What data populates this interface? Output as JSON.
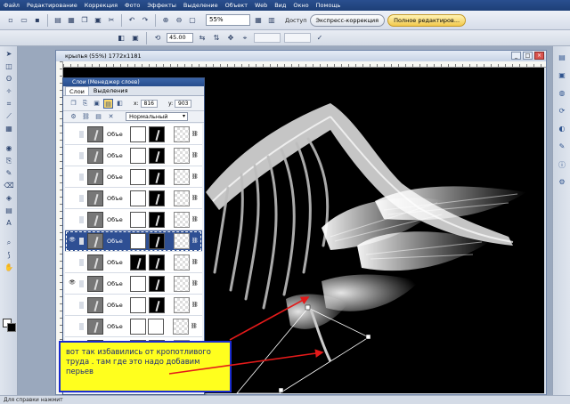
{
  "menu": [
    "Файл",
    "Редактирование",
    "Коррекция",
    "Фото",
    "Эффекты",
    "Выделение",
    "Объект",
    "Web",
    "Вид",
    "Окно",
    "Помощь"
  ],
  "toolbar": {
    "zoom": "55%",
    "access_label": "Доступ",
    "express_btn": "Экспресс-коррекция",
    "full_btn": "Полное редактиров..."
  },
  "toolbar2": {
    "angle": "45.00"
  },
  "document": {
    "title": "крылья (55%) 1772x1181"
  },
  "layers_panel": {
    "title": "Слои (Менеджер слоев)",
    "tabs": [
      "Слои",
      "Выделения"
    ],
    "x_label": "x:",
    "x_value": "816",
    "y_label": "y:",
    "y_value": "903",
    "blend_mode": "Нормальный",
    "layer_name": "Объе"
  },
  "note": {
    "text": "вот так избавились от кропотливого труда . там где это надо добавим перьев"
  },
  "statusbar": {
    "text": "Для справки нажмит"
  },
  "colors": {
    "note_bg": "#ffff1e",
    "note_border": "#1a2bd1",
    "arrow": "#e31a1a",
    "selected_layer": "#2e4f93"
  },
  "icons": [
    "select-icon",
    "move-icon",
    "crop-icon",
    "brush-icon",
    "eraser-icon",
    "zoom-icon",
    "eyedropper-icon",
    "eye-icon",
    "lock-icon",
    "link-icon"
  ]
}
